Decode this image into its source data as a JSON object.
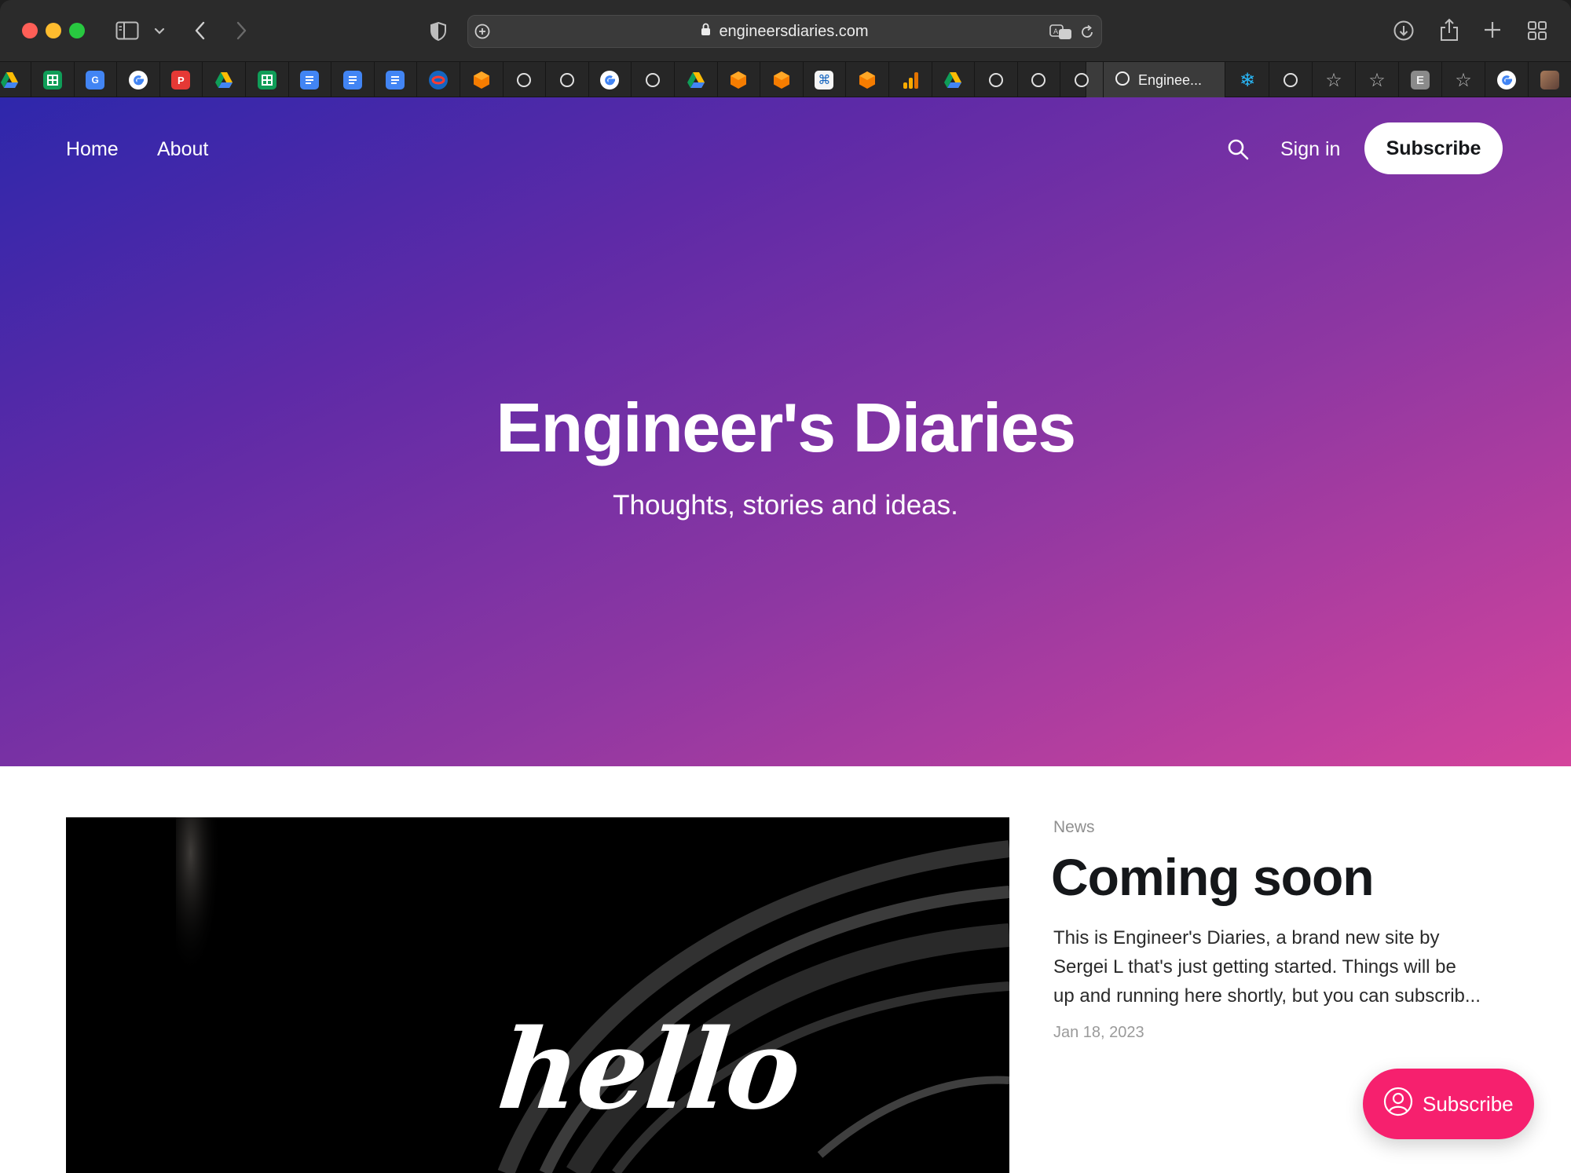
{
  "browser": {
    "url": "engineersdiaries.com",
    "active_tab_title": "Enginee..."
  },
  "nav": {
    "home": "Home",
    "about": "About",
    "sign_in": "Sign in",
    "subscribe": "Subscribe"
  },
  "hero": {
    "title": "Engineer's Diaries",
    "subtitle": "Thoughts, stories and ideas.",
    "gradient_colors": [
      "#2e27ab",
      "#8e37a2",
      "#d4449c"
    ]
  },
  "post": {
    "image_text": "hello",
    "tag": "News",
    "title": "Coming soon",
    "excerpt_lines": [
      "This is Engineer's Diaries, a brand new site by",
      "Sergei L that's just getting started. Things will be",
      "up and running here shortly, but you can subscrib..."
    ],
    "date": "Jan 18, 2023"
  },
  "portal": {
    "label": "Subscribe",
    "color": "#f6206e"
  },
  "favicons": [
    "google-drive-icon",
    "google-sheets-icon",
    "google-translate-icon",
    "google-icon",
    "app-red-icon",
    "google-drive-icon",
    "google-sheets-icon",
    "google-docs-icon",
    "google-docs-icon",
    "google-docs-icon",
    "app-red-blue-icon",
    "cube-orange-icon",
    "blank-circle-icon",
    "blank-circle-icon",
    "google-icon",
    "blank-circle-icon",
    "google-drive-icon",
    "cube-orange-icon",
    "cube-orange-icon",
    "command-icon",
    "cube-orange-icon",
    "analytics-icon",
    "google-drive-icon",
    "blank-circle-icon",
    "blank-circle-icon",
    "blank-circle-icon"
  ],
  "favicons_right": [
    "snowflake-icon",
    "blank-circle-icon",
    "star-icon",
    "star-icon",
    "e-letter-icon",
    "star-icon",
    "google-icon",
    "profile-photo-icon"
  ],
  "favicon_letter": "E"
}
